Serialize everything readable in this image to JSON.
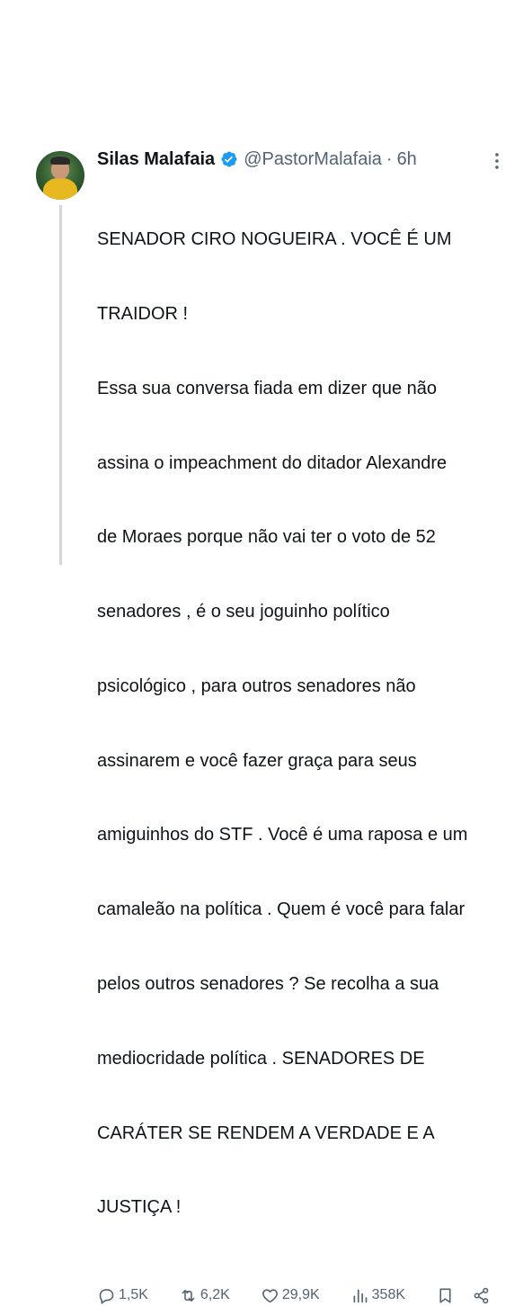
{
  "tweet": {
    "author_name": "Silas Malafaia",
    "handle": "@PastorMalafaia",
    "separator": "·",
    "time": "6h",
    "text_lines": [
      "SENADOR CIRO NOGUEIRA . VOCÊ É UM",
      "TRAIDOR !",
      "Essa sua conversa fiada em dizer que não",
      "assina o impeachment do ditador Alexandre",
      "de Moraes porque não vai ter o voto de 52",
      "senadores , é o seu joguinho político",
      "psicológico , para outros senadores não",
      "assinarem e você fazer graça para seus",
      "amiguinhos do STF . Você é uma raposa e um",
      "camaleão na política . Quem é você para falar",
      "pelos outros senadores ? Se recolha a sua",
      "mediocridade política . SENADORES DE",
      "CARÁTER SE RENDEM A VERDADE E A",
      "JUSTIÇA !"
    ],
    "actions": {
      "replies": "1,5K",
      "retweets": "6,2K",
      "likes": "29,9K",
      "views": "358K"
    },
    "icons": {
      "verified": "verified-badge-icon",
      "more": "more-vertical-icon",
      "reply": "reply-icon",
      "retweet": "retweet-icon",
      "like": "heart-icon",
      "views": "views-icon",
      "bookmark": "bookmark-icon",
      "share": "share-icon"
    },
    "colors": {
      "verified_blue": "#1d9bf0",
      "secondary_text": "#536471",
      "primary_text": "#0f1419"
    }
  }
}
